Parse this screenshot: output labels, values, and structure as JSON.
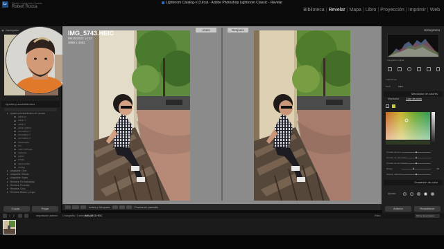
{
  "app": {
    "window_title": "Lightroom Catalog-v13.lrcat - Adobe Photoshop Lightroom Classic - Revelar",
    "badge": "Lr",
    "user_line1": "Studio Lightroom Classic",
    "user_line2": "Robert Rocca"
  },
  "modules": {
    "items": [
      {
        "label": "Biblioteca",
        "active": false
      },
      {
        "label": "Revelar",
        "active": true
      },
      {
        "label": "Mapa",
        "active": false
      },
      {
        "label": "Libro",
        "active": false
      },
      {
        "label": "Proyección",
        "active": false
      },
      {
        "label": "Imprimir",
        "active": false
      },
      {
        "label": "Web",
        "active": false
      }
    ],
    "separator": "|"
  },
  "left_panel": {
    "navigator_label": "Navegador",
    "presets_header": "Ajustes preestablecidos",
    "preset_items": [
      {
        "label": "Ajustes preestablecidos del usuario",
        "type": "group"
      },
      {
        "label": "cálido pr",
        "type": "sub"
      },
      {
        "label": "cálido 1",
        "type": "sub"
      },
      {
        "label": "cálido 2",
        "type": "sub"
      },
      {
        "label": "cálido interior",
        "type": "sub"
      },
      {
        "label": "cinemático 1",
        "type": "sub"
      },
      {
        "label": "cinemático 2",
        "type": "sub"
      },
      {
        "label": "cinemático 3",
        "type": "sub"
      },
      {
        "label": "desaturado",
        "type": "sub"
      },
      {
        "label": "frío",
        "type": "sub"
      },
      {
        "label": "mate contraste",
        "type": "sub"
      },
      {
        "label": "nocturno",
        "type": "sub"
      },
      {
        "label": "pastel",
        "type": "sub"
      },
      {
        "label": "retrato",
        "type": "sub"
      },
      {
        "label": "sepia suave",
        "type": "sub"
      },
      {
        "label": "vintage",
        "type": "sub"
      },
      {
        "label": "Adaptable: Cielo",
        "type": "group"
      },
      {
        "label": "Adaptable: Retrato",
        "type": "group"
      },
      {
        "label": "Adaptable: Sujeto",
        "type": "group"
      },
      {
        "label": "Remixes: Por intensidad",
        "type": "group"
      },
      {
        "label": "Remixes: Por estilo",
        "type": "group"
      },
      {
        "label": "Remixes: Color",
        "type": "group"
      },
      {
        "label": "Remixes: Blanco y negro",
        "type": "group"
      }
    ],
    "copy_button": "Copiar...",
    "paste_button": "Pegar"
  },
  "viewer": {
    "before_label": "Antes",
    "after_label": "Después",
    "file_name": "IMG_5743.HEIC",
    "file_date": "09/10/2023 14:37",
    "file_size": "3088 x 4032"
  },
  "toolbar": {
    "view_mode_label": "Antes y Después:",
    "proof_label": "Prueba en pantalla"
  },
  "right_panel": {
    "histogram_title": "Histograma",
    "exif_line": "Fotografía original",
    "profile_label": "Perfil",
    "profile_value": "Color",
    "tratamiento_label": "Tratamiento",
    "color_mixer_title": "Mezclador de colores",
    "cm_tabs": [
      {
        "label": "Mezclador",
        "on": false
      },
      {
        "label": "Color de punto",
        "on": true
      }
    ],
    "sliders": [
      {
        "label": "Cambio de tono",
        "value": "",
        "pos": 0.5
      },
      {
        "label": "Cambio de saturación",
        "value": "",
        "pos": 0.5
      },
      {
        "label": "Cambio de luminancia",
        "value": "",
        "pos": 0.5
      },
      {
        "label": "Rango",
        "value": "-19",
        "pos": 0.42
      },
      {
        "label": "Mostrar máscara",
        "value": "",
        "pos": 0.5
      }
    ],
    "grading_title": "Gradación de color",
    "wheels_label": "Ajustar:",
    "prev_button": "Anterior",
    "reset_button": "Restablecer"
  },
  "filmbar": {
    "pages": [
      "1",
      "2"
    ],
    "source_label": "Importación anterior",
    "count_label": "1 fotografía / 1 seleccionada /",
    "selected_file": "IMG_5743.HEIC",
    "filter_label": "Filtro:",
    "filter_value": "Filtros desactivados"
  },
  "colors": {
    "accent_blue": "#2d6cb0",
    "panel_bg": "#1f1f1f",
    "viewer_bg": "#8b8b8b"
  }
}
